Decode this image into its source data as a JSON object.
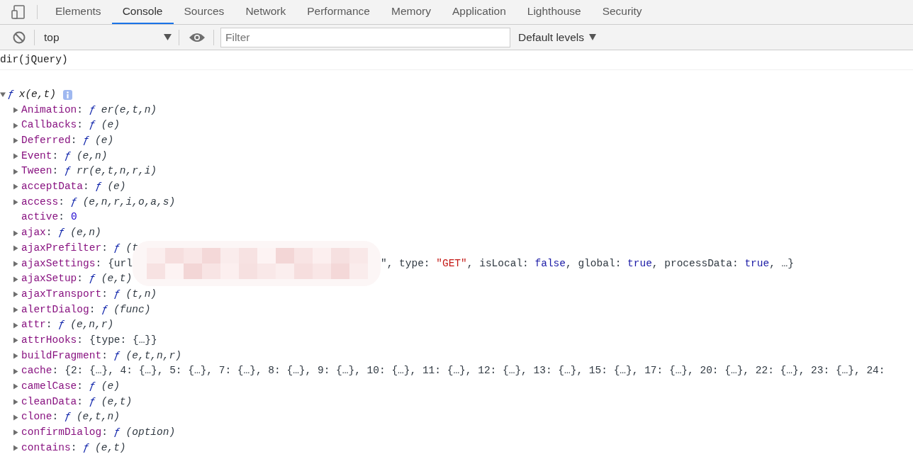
{
  "tabs": [
    {
      "label": "Elements",
      "selected": false
    },
    {
      "label": "Console",
      "selected": true
    },
    {
      "label": "Sources",
      "selected": false
    },
    {
      "label": "Network",
      "selected": false
    },
    {
      "label": "Performance",
      "selected": false
    },
    {
      "label": "Memory",
      "selected": false
    },
    {
      "label": "Application",
      "selected": false
    },
    {
      "label": "Lighthouse",
      "selected": false
    },
    {
      "label": "Security",
      "selected": false
    }
  ],
  "toolbar": {
    "context": "top",
    "filter_placeholder": "Filter",
    "levels": "Default levels"
  },
  "command": "dir(jQuery)",
  "result": {
    "expanded": true,
    "prefix": "ƒ",
    "signature": "x(e,t)",
    "rows": [
      {
        "kind": "function",
        "name": "Animation",
        "sep": ":",
        "fn": "ƒ",
        "expandable": true,
        "signature": "er(e,t,n)"
      },
      {
        "kind": "function",
        "name": "Callbacks",
        "sep": ":",
        "fn": "ƒ",
        "expandable": true,
        "signature": "(e)"
      },
      {
        "kind": "function",
        "name": "Deferred",
        "sep": ":",
        "fn": "ƒ",
        "expandable": true,
        "signature": "(e)"
      },
      {
        "kind": "function",
        "name": "Event",
        "sep": ":",
        "fn": "ƒ",
        "expandable": true,
        "signature": "(e,n)"
      },
      {
        "kind": "function",
        "name": "Tween",
        "sep": ":",
        "fn": "ƒ",
        "expandable": true,
        "signature": "rr(e,t,n,r,i)"
      },
      {
        "kind": "function",
        "name": "acceptData",
        "sep": ":",
        "fn": "ƒ",
        "expandable": true,
        "signature": "(e)"
      },
      {
        "kind": "function",
        "name": "access",
        "sep": ":",
        "fn": "ƒ",
        "expandable": true,
        "signature": "(e,n,r,i,o,a,s)"
      },
      {
        "kind": "number",
        "name": "active",
        "sep": ":",
        "expandable": false,
        "value": "0"
      },
      {
        "kind": "function",
        "name": "ajax",
        "sep": ":",
        "fn": "ƒ",
        "expandable": true,
        "signature": "(e,n)"
      },
      {
        "kind": "function",
        "name": "ajaxPrefilter",
        "sep": ":",
        "fn": "ƒ",
        "expandable": true,
        "signature": "(t"
      },
      {
        "kind": "object",
        "name": "ajaxSettings",
        "sep": ":",
        "expandable": true,
        "parts": [
          {
            "kind": "plain",
            "text": "{url"
          },
          {
            "kind": "redacted"
          },
          {
            "kind": "plain",
            "text": "\", type: "
          },
          {
            "kind": "string",
            "text": "\"GET\""
          },
          {
            "kind": "plain",
            "text": ", isLocal: "
          },
          {
            "kind": "literal",
            "text": "false"
          },
          {
            "kind": "plain",
            "text": ", global: "
          },
          {
            "kind": "literal",
            "text": "true"
          },
          {
            "kind": "plain",
            "text": ", processData: "
          },
          {
            "kind": "literal",
            "text": "true"
          },
          {
            "kind": "plain",
            "text": ", …}"
          }
        ]
      },
      {
        "kind": "function",
        "name": "ajaxSetup",
        "sep": ":",
        "fn": "ƒ",
        "expandable": true,
        "signature": "(e,t)"
      },
      {
        "kind": "function",
        "name": "ajaxTransport",
        "sep": ":",
        "fn": "ƒ",
        "expandable": true,
        "signature": "(t,n)"
      },
      {
        "kind": "function",
        "name": "alertDialog",
        "sep": ":",
        "fn": "ƒ",
        "expandable": true,
        "signature": "(func)"
      },
      {
        "kind": "function",
        "name": "attr",
        "sep": ":",
        "fn": "ƒ",
        "expandable": true,
        "signature": "(e,n,r)"
      },
      {
        "kind": "object",
        "name": "attrHooks",
        "sep": ":",
        "expandable": true,
        "parts": [
          {
            "kind": "plain",
            "text": "{type: {…}}"
          }
        ]
      },
      {
        "kind": "function",
        "name": "buildFragment",
        "sep": ":",
        "fn": "ƒ",
        "expandable": true,
        "signature": "(e,t,n,r)"
      },
      {
        "kind": "object",
        "name": "cache",
        "sep": ":",
        "expandable": true,
        "parts": [
          {
            "kind": "plain",
            "text": "{2: {…}, 4: {…}, 5: {…}, 7: {…}, 8: {…}, 9: {…}, 10: {…}, 11: {…}, 12: {…}, 13: {…}, 15: {…}, 17: {…}, 20: {…}, 22: {…}, 23: {…}, 24:"
          }
        ]
      },
      {
        "kind": "function",
        "name": "camelCase",
        "sep": ":",
        "fn": "ƒ",
        "expandable": true,
        "signature": "(e)"
      },
      {
        "kind": "function",
        "name": "cleanData",
        "sep": ":",
        "fn": "ƒ",
        "expandable": true,
        "signature": "(e,t)"
      },
      {
        "kind": "function",
        "name": "clone",
        "sep": ":",
        "fn": "ƒ",
        "expandable": true,
        "signature": "(e,t,n)"
      },
      {
        "kind": "function",
        "name": "confirmDialog",
        "sep": ":",
        "fn": "ƒ",
        "expandable": true,
        "signature": "(option)"
      },
      {
        "kind": "function",
        "name": "contains",
        "sep": ":",
        "fn": "ƒ",
        "expandable": true,
        "signature": "(e,t)"
      }
    ]
  }
}
